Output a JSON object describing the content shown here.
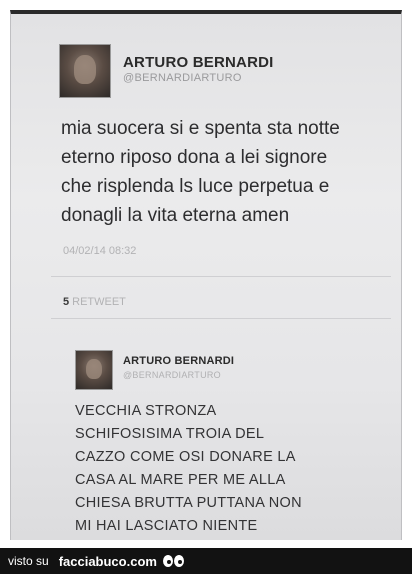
{
  "tweet": {
    "author": "ARTURO BERNARDI",
    "handle": "@BERNARDIARTURO",
    "lines": [
      "mia suocera si e spenta sta notte",
      "eterno riposo dona a lei signore",
      "che risplenda ls luce perpetua e",
      "donagli la vita eterna amen"
    ],
    "timestamp": "04/02/14 08:32",
    "retweet_count": "5",
    "retweet_label": "RETWEET"
  },
  "reply": {
    "author": "ARTURO BERNARDI",
    "handle": "@BERNARDIARTURO",
    "lines": [
      "VECCHIA STRONZA",
      "SCHIFOSISIMA TROIA DEL",
      "CAZZO COME OSI DONARE LA",
      "CASA AL MARE PER ME ALLA",
      "CHIESA BRUTTA PUTTANA NON",
      "MI HAI LASCIATO NIENTE"
    ]
  },
  "footer": {
    "prefix": "visto su",
    "site": "facciabuco.com"
  },
  "icons": {
    "watermark": "eyes-icon",
    "avatar": "avatar"
  }
}
